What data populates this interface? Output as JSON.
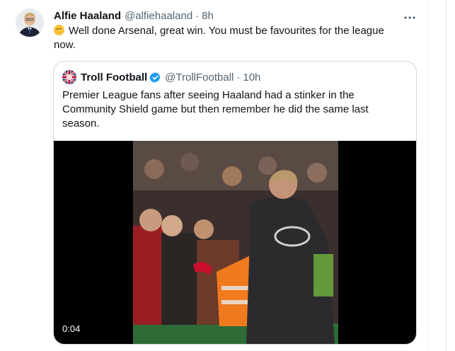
{
  "tweet": {
    "author_name": "Alfie Haaland",
    "author_handle": "@alfiehaaland",
    "separator": "·",
    "time": "8h",
    "text": "Well done Arsenal, great win. You must be favourites for the league now.",
    "emoji": "winking-face",
    "more_icon": "more-horizontal-icon"
  },
  "quoted": {
    "author_name": "Troll Football",
    "author_handle": "@TrollFootball",
    "separator": "·",
    "time": "10h",
    "verified": true,
    "text": "Premier League fans after seeing Haaland had a stinker in the Community Shield game but then remember he did the same last season.",
    "video": {
      "timestamp": "0:04"
    }
  },
  "colors": {
    "text_primary": "#0f1419",
    "text_secondary": "#536471",
    "verified_blue": "#1d9bf0",
    "border": "#cfd9de"
  }
}
